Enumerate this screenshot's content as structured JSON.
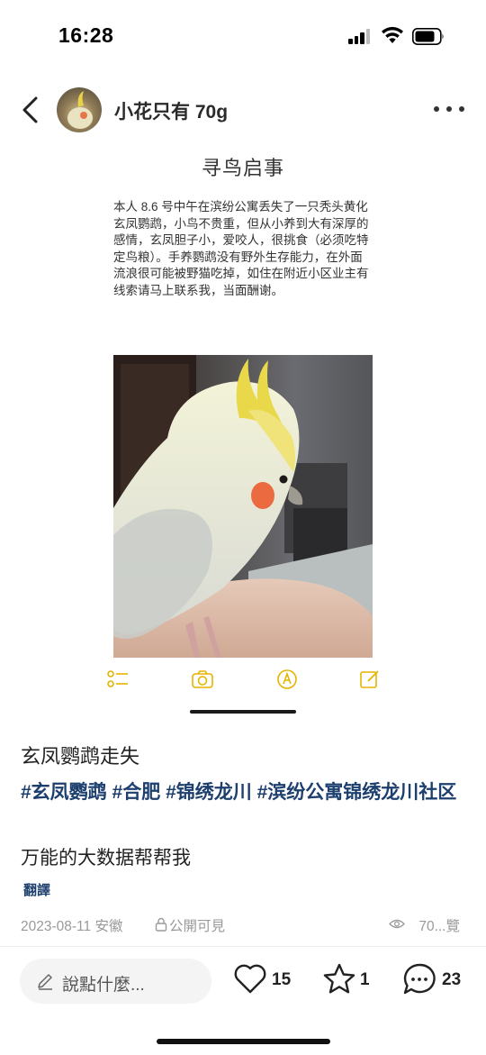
{
  "status_bar": {
    "time": "16:28"
  },
  "header": {
    "author_name": "小花只有 70g"
  },
  "poster": {
    "title": "寻鸟启事",
    "text": "本人 8.6 号中午在滨纷公寓丢失了一只秃头黄化玄凤鹦鹉，小鸟不贵重，但从小养到大有深厚的感情，玄凤胆子小，爱咬人，很挑食（必须吃特定鸟粮）。手养鹦鹉没有野外生存能力，在外面流浪很可能被野猫吃掉，如住在附近小区业主有线索请马上联系我，当面酬谢。"
  },
  "post": {
    "title": "玄凤鹦鹉走失",
    "hashtags": [
      "#玄凤鹦鹉",
      "#合肥",
      "#锦绣龙川",
      "#滨纷公寓锦绣龙川社区"
    ],
    "description": "万能的大数据帮帮我",
    "translate_label": "翻譯"
  },
  "meta": {
    "date_location": "2023-08-11 安徽",
    "visibility": "公開可見",
    "views": "70...覽"
  },
  "bottom_bar": {
    "comment_placeholder": "說點什麼...",
    "likes": "15",
    "favorites": "1",
    "comments": "23"
  },
  "colors": {
    "hashtag": "#1d3f6e",
    "toolbar_icon": "#e6b400",
    "meta_text": "#9a9a9a"
  }
}
